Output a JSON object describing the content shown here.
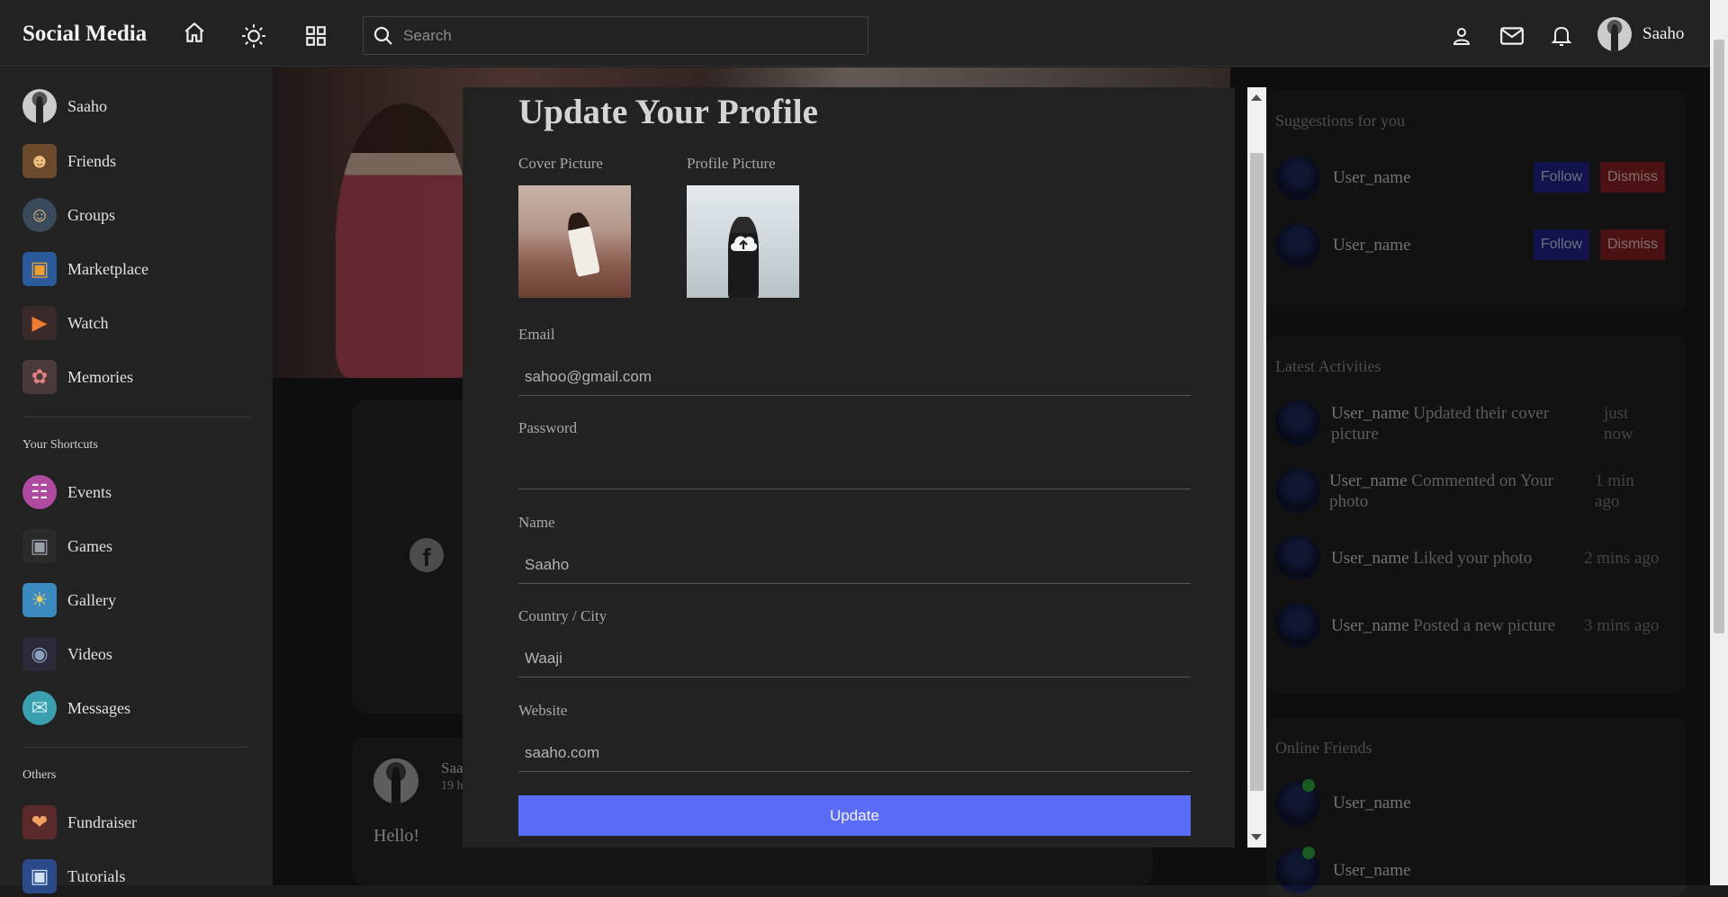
{
  "navbar": {
    "logo": "Social Media",
    "search_placeholder": "Search",
    "user_name": "Saaho",
    "icons": [
      "home-icon",
      "sun-icon",
      "grid-icon",
      "person-icon",
      "mail-icon",
      "bell-icon"
    ]
  },
  "left_sidebar": {
    "user": "Saaho",
    "items": [
      {
        "label": "Friends",
        "icon": "friends-icon"
      },
      {
        "label": "Groups",
        "icon": "groups-icon"
      },
      {
        "label": "Marketplace",
        "icon": "marketplace-icon"
      },
      {
        "label": "Watch",
        "icon": "watch-icon"
      },
      {
        "label": "Memories",
        "icon": "memories-icon"
      }
    ],
    "shortcuts_heading": "Your Shortcuts",
    "shortcuts": [
      {
        "label": "Events",
        "icon": "events-icon"
      },
      {
        "label": "Games",
        "icon": "games-icon"
      },
      {
        "label": "Gallery",
        "icon": "gallery-icon"
      },
      {
        "label": "Videos",
        "icon": "videos-icon"
      },
      {
        "label": "Messages",
        "icon": "messages-icon"
      }
    ],
    "others_heading": "Others",
    "others": [
      {
        "label": "Fundraiser",
        "icon": "fundraiser-icon"
      },
      {
        "label": "Tutorials",
        "icon": "tutorials-icon"
      }
    ]
  },
  "post": {
    "user": "Saa",
    "time": "19 h",
    "text": "Hello!"
  },
  "suggestions": {
    "title": "Suggestions for you",
    "users": [
      {
        "name": "User_name",
        "follow": "Follow",
        "dismiss": "Dismiss"
      },
      {
        "name": "User_name",
        "follow": "Follow",
        "dismiss": "Dismiss"
      }
    ]
  },
  "activities": {
    "title": "Latest Activities",
    "items": [
      {
        "user": "User_name",
        "action": " Updated their cover picture",
        "time": "just now"
      },
      {
        "user": "User_name",
        "action": " Commented on Your photo",
        "time": "1 min ago"
      },
      {
        "user": "User_name",
        "action": " Liked your photo",
        "time": "2 mins ago"
      },
      {
        "user": "User_name",
        "action": " Posted a new picture",
        "time": "3 mins ago"
      }
    ]
  },
  "online_friends": {
    "title": "Online Friends",
    "users": [
      "User_name",
      "User_name"
    ]
  },
  "modal": {
    "title": "Update Your Profile",
    "cover_label": "Cover Picture",
    "profile_label": "Profile Picture",
    "email_label": "Email",
    "email_value": "sahoo@gmail.com",
    "password_label": "Password",
    "password_value": "",
    "name_label": "Name",
    "name_value": "Saaho",
    "country_label": "Country / City",
    "country_value": "Waaji",
    "website_label": "Website",
    "website_value": "saaho.com",
    "update_label": "Update"
  },
  "colors": {
    "accent": "#5a6cf5",
    "follow": "#22228a",
    "dismiss": "#8a1f22",
    "online": "#2fa840"
  }
}
